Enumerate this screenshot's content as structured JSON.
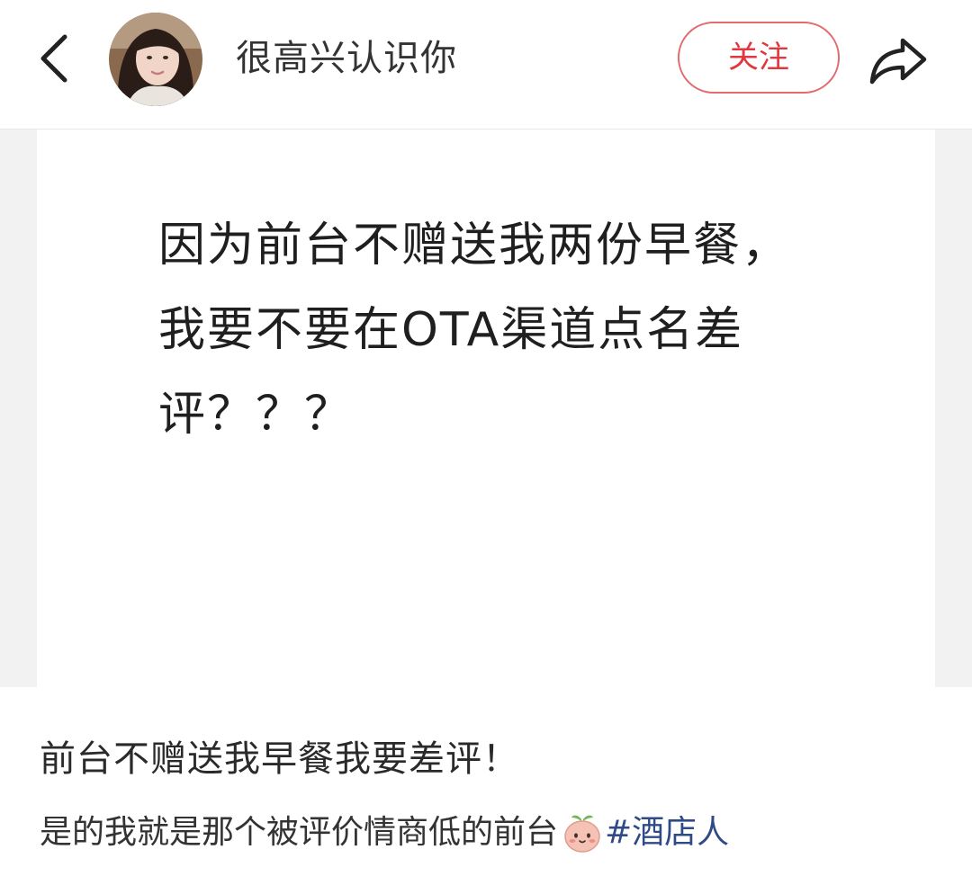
{
  "header": {
    "back_icon": "chevron-left-icon",
    "username": "很高兴认识你",
    "follow_label": "关注",
    "share_icon": "share-arrow-icon"
  },
  "post": {
    "image_text": "因为前台不赠送我两份早餐，我要不要在OTA渠道点名差评？？？",
    "title": "前台不赠送我早餐我要差评！",
    "desc_text": "是的我就是那个被评价情商低的前台",
    "emoji": "peach-face-emoji",
    "hashtag": "#酒店人"
  },
  "colors": {
    "follow_border": "#e26b70",
    "follow_text": "#e0383e",
    "hashtag": "#2f4a86",
    "image_bg": "#f2f2f2"
  }
}
